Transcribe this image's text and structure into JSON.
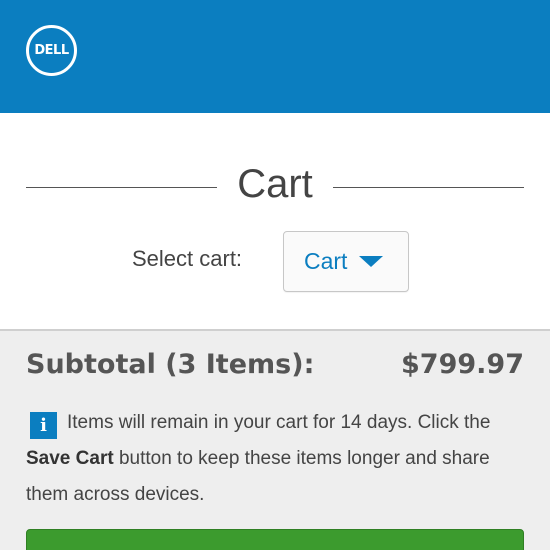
{
  "header": {
    "logo_text": "DELL",
    "brand_color": "#0b7ec0"
  },
  "page": {
    "title": "Cart"
  },
  "cart_select": {
    "label": "Select cart:",
    "selected": "Cart"
  },
  "summary": {
    "subtotal_label": "Subtotal (3 Items):",
    "subtotal_value": "$799.97",
    "notice_part1": "Items will remain in your cart for 14 days. Click the ",
    "notice_bold": "Save Cart",
    "notice_part2": " button to keep these items longer and share them across devices.",
    "checkout_color": "#3c9b2e"
  },
  "icons": {
    "info": "info-icon",
    "dropdown": "chevron-down-icon"
  }
}
